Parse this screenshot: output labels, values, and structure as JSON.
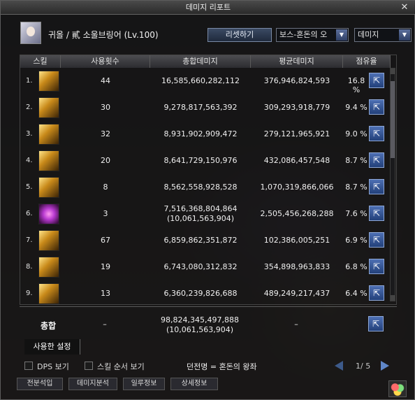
{
  "window": {
    "title": "데미지 리포트",
    "close_glyph": "✕"
  },
  "header": {
    "character": "귀올 / 貳 소울브링어 (Lv.100)",
    "reset_label": "리셋하기",
    "boss_dropdown": "보스-혼돈의 오",
    "type_dropdown": "데미지",
    "arrow_glyph": "▼"
  },
  "columns": [
    "스킬",
    "사용횟수",
    "총합데미지",
    "평균데미지",
    "점유율"
  ],
  "rows": [
    {
      "idx": "1.",
      "uses": "44",
      "total": "16,585,660,282,112",
      "total_sub": "",
      "avg": "376,946,824,593",
      "share": "16.8 %",
      "icon": "gold"
    },
    {
      "idx": "2.",
      "uses": "30",
      "total": "9,278,817,563,392",
      "total_sub": "",
      "avg": "309,293,918,779",
      "share": "9.4 %",
      "icon": "gold"
    },
    {
      "idx": "3.",
      "uses": "32",
      "total": "8,931,902,909,472",
      "total_sub": "",
      "avg": "279,121,965,921",
      "share": "9.0 %",
      "icon": "gold"
    },
    {
      "idx": "4.",
      "uses": "20",
      "total": "8,641,729,150,976",
      "total_sub": "",
      "avg": "432,086,457,548",
      "share": "8.7 %",
      "icon": "gold"
    },
    {
      "idx": "5.",
      "uses": "8",
      "total": "8,562,558,928,528",
      "total_sub": "",
      "avg": "1,070,319,866,066",
      "share": "8.7 %",
      "icon": "gold"
    },
    {
      "idx": "6.",
      "uses": "3",
      "total": "7,516,368,804,864",
      "total_sub": "(10,061,563,904)",
      "avg": "2,505,456,268,288",
      "share": "7.6 %",
      "icon": "violet"
    },
    {
      "idx": "7.",
      "uses": "67",
      "total": "6,859,862,351,872",
      "total_sub": "",
      "avg": "102,386,005,251",
      "share": "6.9 %",
      "icon": "gold"
    },
    {
      "idx": "8.",
      "uses": "19",
      "total": "6,743,080,312,832",
      "total_sub": "",
      "avg": "354,898,963,833",
      "share": "6.8 %",
      "icon": "gold"
    },
    {
      "idx": "9.",
      "uses": "13",
      "total": "6,360,239,826,688",
      "total_sub": "",
      "avg": "489,249,217,437",
      "share": "6.4 %",
      "icon": "gold"
    }
  ],
  "share_glyph": "⇱",
  "total": {
    "label": "총합",
    "uses": "–",
    "total": "98,824,345,497,888",
    "total_sub": "(10,061,563,904)",
    "avg": "–"
  },
  "tabs": {
    "used_settings": "사용한 설정"
  },
  "bottom": {
    "dps_label": "DPS 보기",
    "skill_order_label": "스킬 순서 보기",
    "dungeon": "던전명 = 혼돈의 왕좌",
    "page": "1/ 5"
  },
  "outside": {
    "btn1": "전분석입",
    "btn2": "데미지분석",
    "btn3": "일루정보",
    "btn4": "상세정보"
  }
}
